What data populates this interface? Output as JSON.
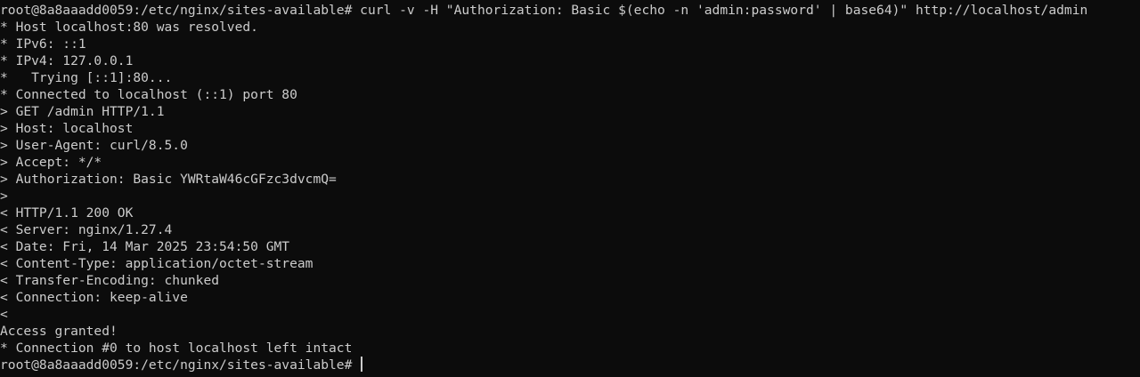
{
  "terminal": {
    "lines": [
      "root@8a8aaadd0059:/etc/nginx/sites-available# curl -v -H \"Authorization: Basic $(echo -n 'admin:password' | base64)\" http://localhost/admin",
      "* Host localhost:80 was resolved.",
      "* IPv6: ::1",
      "* IPv4: 127.0.0.1",
      "*   Trying [::1]:80...",
      "* Connected to localhost (::1) port 80",
      "> GET /admin HTTP/1.1",
      "> Host: localhost",
      "> User-Agent: curl/8.5.0",
      "> Accept: */*",
      "> Authorization: Basic YWRtaW46cGFzc3dvcmQ=",
      ">",
      "< HTTP/1.1 200 OK",
      "< Server: nginx/1.27.4",
      "< Date: Fri, 14 Mar 2025 23:54:50 GMT",
      "< Content-Type: application/octet-stream",
      "< Transfer-Encoding: chunked",
      "< Connection: keep-alive",
      "<",
      "Access granted!",
      "* Connection #0 to host localhost left intact"
    ],
    "prompt": "root@8a8aaadd0059:/etc/nginx/sites-available# "
  }
}
